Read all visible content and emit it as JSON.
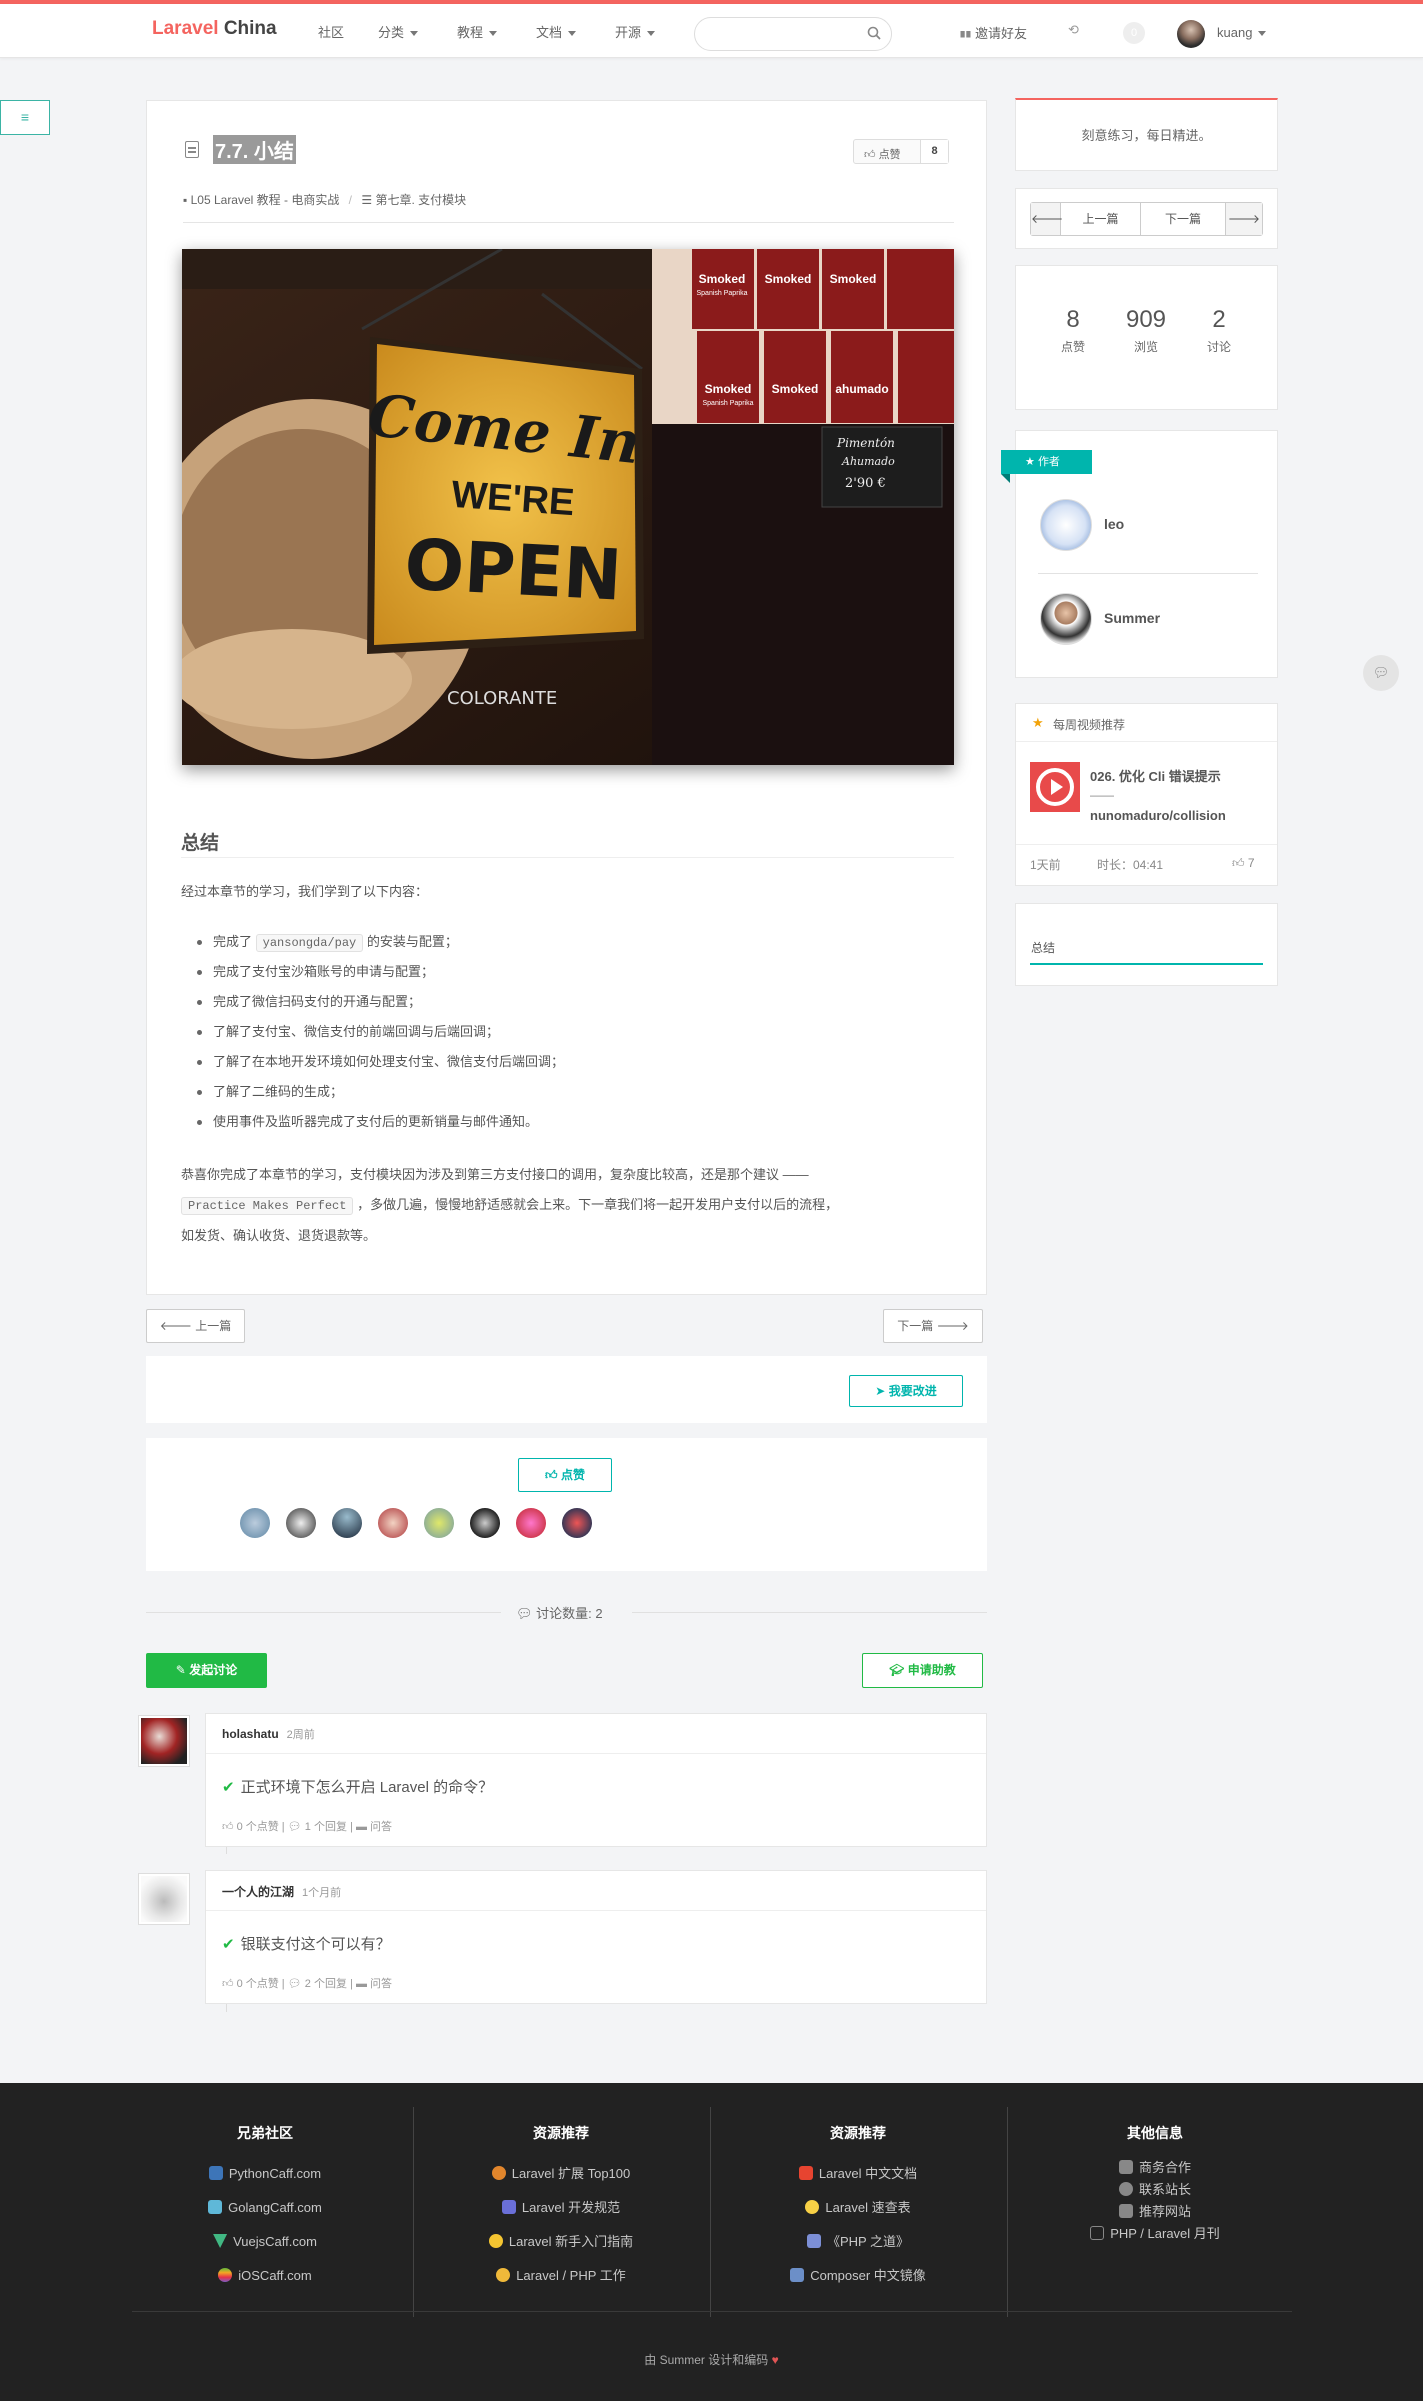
{
  "brand": {
    "name_red": "Laravel",
    "name_dark": "China",
    "accent": "#f4645f"
  },
  "nav": {
    "links": [
      {
        "label": "社区",
        "dropdown": false
      },
      {
        "label": "分类",
        "dropdown": true
      },
      {
        "label": "教程",
        "dropdown": true
      },
      {
        "label": "文档",
        "dropdown": true
      },
      {
        "label": "开源",
        "dropdown": true
      }
    ],
    "search_placeholder": "",
    "invite": "邀请好友",
    "notification_count": "0",
    "username": "kuang"
  },
  "article": {
    "title": "7.7. 小结",
    "like_label": "点赞",
    "like_count": "8",
    "breadcrumb": [
      "L05 Laravel 教程 - 电商实战",
      "第七章. 支付模块"
    ],
    "image_text": {
      "sign_line1": "Come In",
      "sign_line2": "WE'RE",
      "sign_line3": "OPEN",
      "brand": "COLORANTE",
      "label_line1": "Pimentón",
      "label_line2": "Ahumado",
      "label_price": "2'90 €",
      "tin_text": "Smoked",
      "tin_sub": "Spanish Paprika",
      "tin_alt": "ahumado"
    },
    "heading": "总结",
    "intro": "经过本章节的学习，我们学到了以下内容：",
    "items": [
      {
        "pre": "完成了",
        "code": "yansongda/pay",
        "post": "的安装与配置；"
      },
      {
        "text": "完成了支付宝沙箱账号的申请与配置；"
      },
      {
        "text": "完成了微信扫码支付的开通与配置；"
      },
      {
        "text": "了解了支付宝、微信支付的前端回调与后端回调；"
      },
      {
        "text": "了解了在本地开发环境如何处理支付宝、微信支付后端回调；"
      },
      {
        "text": "了解了二维码的生成；"
      },
      {
        "text": "使用事件及监听器完成了支付后的更新销量与邮件通知。"
      }
    ],
    "outro_pre": "恭喜你完成了本章节的学习，支付模块因为涉及到第三方支付接口的调用，复杂度比较高，还是那个建议 ——",
    "outro_code": "Practice Makes Perfect",
    "outro_post": "，多做几遍，慢慢地舒适感就会上来。下一章我们将一起开发用户支付以后的流程，",
    "outro_post2": "如发货、确认收货、退货退款等。"
  },
  "pager": {
    "prev": "上一篇",
    "next": "下一篇"
  },
  "improve": "我要改进",
  "vote": {
    "label": "点赞"
  },
  "discussion": {
    "label": "讨论数量: 2",
    "start": "发起讨论",
    "help": "申请助教",
    "replies": [
      {
        "user": "holashatu",
        "time": "2周前",
        "question": "正式环境下怎么开启 Laravel 的命令？",
        "meta": [
          "0 个点赞",
          "1 个回复",
          "问答"
        ]
      },
      {
        "user": "一个人的江湖",
        "time": "1个月前",
        "question": "银联支付这个可以有？",
        "meta": [
          "0 个点赞",
          "2 个回复",
          "问答"
        ]
      }
    ]
  },
  "sidebar": {
    "motto": "刻意练习，每日精进。",
    "prev": "上一篇",
    "next": "下一篇",
    "stats": [
      {
        "n": "8",
        "l": "点赞"
      },
      {
        "n": "909",
        "l": "浏览"
      },
      {
        "n": "2",
        "l": "讨论"
      }
    ],
    "author_label": "作者",
    "authors": [
      "leo",
      "Summer"
    ],
    "video": {
      "header": "每周视频推荐",
      "title": "026. 优化 Cli 错误提示",
      "sep": "——",
      "subtitle": "nunomaduro/collision",
      "ago": "1天前",
      "duration": "时长：04:41",
      "likes": "7"
    },
    "toc": "总结"
  },
  "footer": {
    "cols": [
      {
        "title": "兄弟社区",
        "items": [
          "PythonCaff.com",
          "GolangCaff.com",
          "VuejsCaff.com",
          "iOSCaff.com"
        ]
      },
      {
        "title": "资源推荐",
        "items": [
          "Laravel 扩展 Top100",
          "Laravel 开发规范",
          "Laravel 新手入门指南",
          "Laravel / PHP 工作"
        ]
      },
      {
        "title": "资源推荐",
        "items": [
          "Laravel 中文文档",
          "Laravel 速查表",
          "《PHP 之道》",
          "Composer 中文镜像"
        ]
      },
      {
        "title": "其他信息",
        "items": [
          "商务合作",
          "联系站长",
          "推荐网站",
          "PHP / Laravel 月刊"
        ]
      }
    ],
    "credit": "由 Summer 设计和编码"
  }
}
